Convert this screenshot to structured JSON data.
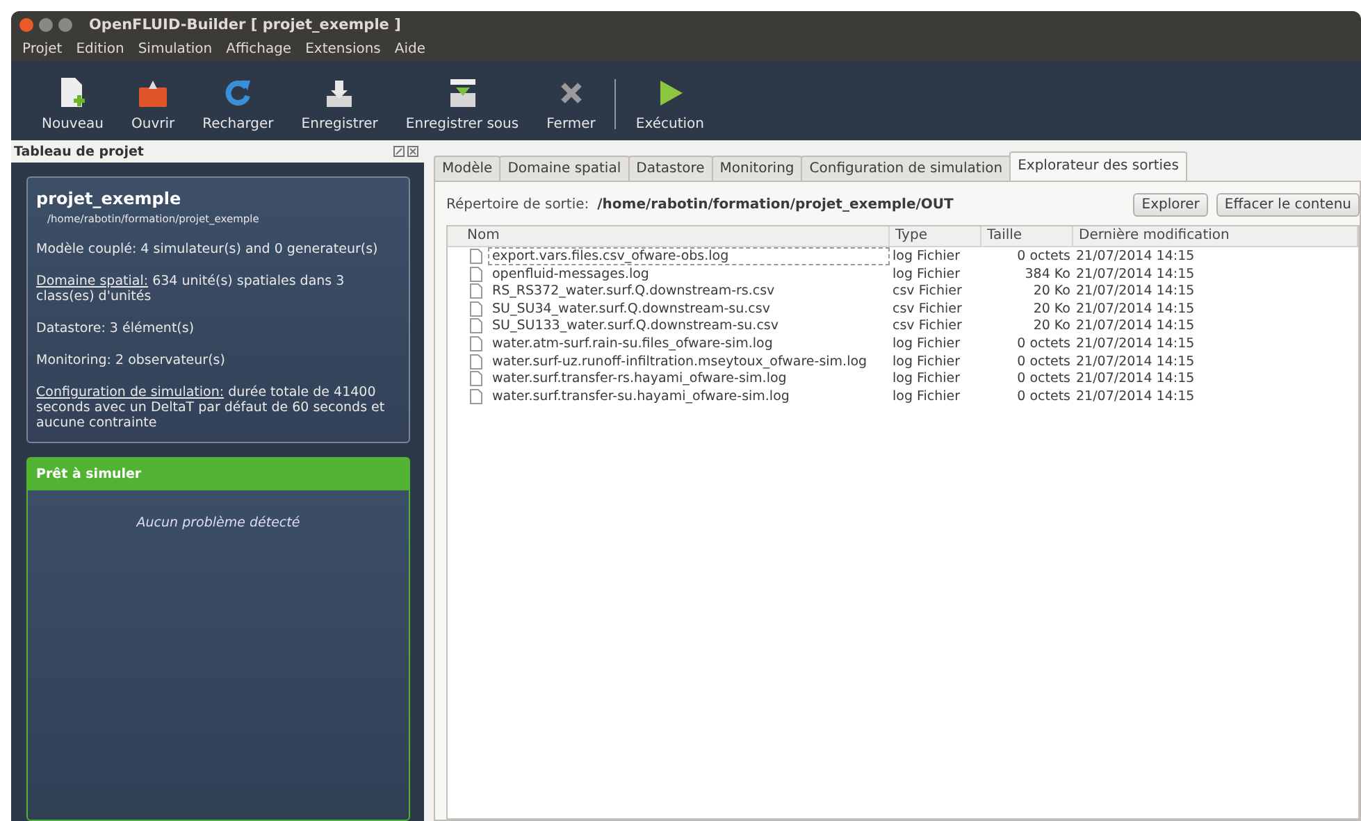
{
  "window": {
    "title": "OpenFLUID-Builder [ projet_exemple ]"
  },
  "menu": [
    "Projet",
    "Edition",
    "Simulation",
    "Affichage",
    "Extensions",
    "Aide"
  ],
  "toolbar": [
    {
      "label": "Nouveau",
      "kind": "new"
    },
    {
      "label": "Ouvrir",
      "kind": "open"
    },
    {
      "label": "Recharger",
      "kind": "reload"
    },
    {
      "label": "Enregistrer",
      "kind": "save"
    },
    {
      "label": "Enregistrer sous",
      "kind": "saveas"
    },
    {
      "label": "Fermer",
      "kind": "close"
    },
    {
      "label": "Exécution",
      "kind": "run"
    }
  ],
  "dock": {
    "title": "Tableau de projet",
    "project": {
      "name": "projet_exemple",
      "path": "/home/rabotin/formation/projet_exemple",
      "info": [
        {
          "text": "Modèle couplé: 4 simulateur(s) and 0 generateur(s)"
        },
        {
          "link": "Domaine spatial:",
          "text": " 634 unité(s) spatiales dans 3 class(es) d'unités"
        },
        {
          "text": "Datastore: 3 élément(s)"
        },
        {
          "text": "Monitoring: 2 observateur(s)"
        },
        {
          "link": "Configuration de simulation:",
          "text": " durée totale de 41400 seconds avec un DeltaT par défaut de 60 seconds et aucune contrainte"
        }
      ]
    },
    "status": {
      "kind": "ready",
      "title": "Prêt à simuler",
      "message": "Aucun problème détecté"
    }
  },
  "tabs": [
    {
      "label": "Modèle",
      "selected": false
    },
    {
      "label": "Domaine spatial",
      "selected": false
    },
    {
      "label": "Datastore",
      "selected": false
    },
    {
      "label": "Monitoring",
      "selected": false
    },
    {
      "label": "Configuration de simulation",
      "selected": false
    },
    {
      "label": "Explorateur des sorties",
      "selected": true
    }
  ],
  "output": {
    "label": "Répertoire de sortie:",
    "path": "/home/rabotin/formation/projet_exemple/OUT",
    "buttons": [
      "Explorer",
      "Effacer le contenu"
    ]
  },
  "table": {
    "columns": [
      "Nom",
      "Type",
      "Taille",
      "Dernière modification"
    ],
    "rows": [
      {
        "name": "export.vars.files.csv_ofware-obs.log",
        "type": "log Fichier",
        "size": "0 octets",
        "date": "21/07/2014 14:15",
        "focused": true
      },
      {
        "name": "openfluid-messages.log",
        "type": "log Fichier",
        "size": "384 Ko",
        "date": "21/07/2014 14:15",
        "focused": false
      },
      {
        "name": "RS_RS372_water.surf.Q.downstream-rs.csv",
        "type": "csv Fichier",
        "size": "20 Ko",
        "date": "21/07/2014 14:15",
        "focused": false
      },
      {
        "name": "SU_SU34_water.surf.Q.downstream-su.csv",
        "type": "csv Fichier",
        "size": "20 Ko",
        "date": "21/07/2014 14:15",
        "focused": false
      },
      {
        "name": "SU_SU133_water.surf.Q.downstream-su.csv",
        "type": "csv Fichier",
        "size": "20 Ko",
        "date": "21/07/2014 14:15",
        "focused": false
      },
      {
        "name": "water.atm-surf.rain-su.files_ofware-sim.log",
        "type": "log Fichier",
        "size": "0 octets",
        "date": "21/07/2014 14:15",
        "focused": false
      },
      {
        "name": "water.surf-uz.runoff-infiltration.mseytoux_ofware-sim.log",
        "type": "log Fichier",
        "size": "0 octets",
        "date": "21/07/2014 14:15",
        "focused": false
      },
      {
        "name": "water.surf.transfer-rs.hayami_ofware-sim.log",
        "type": "log Fichier",
        "size": "0 octets",
        "date": "21/07/2014 14:15",
        "focused": false
      },
      {
        "name": "water.surf.transfer-su.hayami_ofware-sim.log",
        "type": "log Fichier",
        "size": "0 octets",
        "date": "21/07/2014 14:15",
        "focused": false
      }
    ]
  }
}
